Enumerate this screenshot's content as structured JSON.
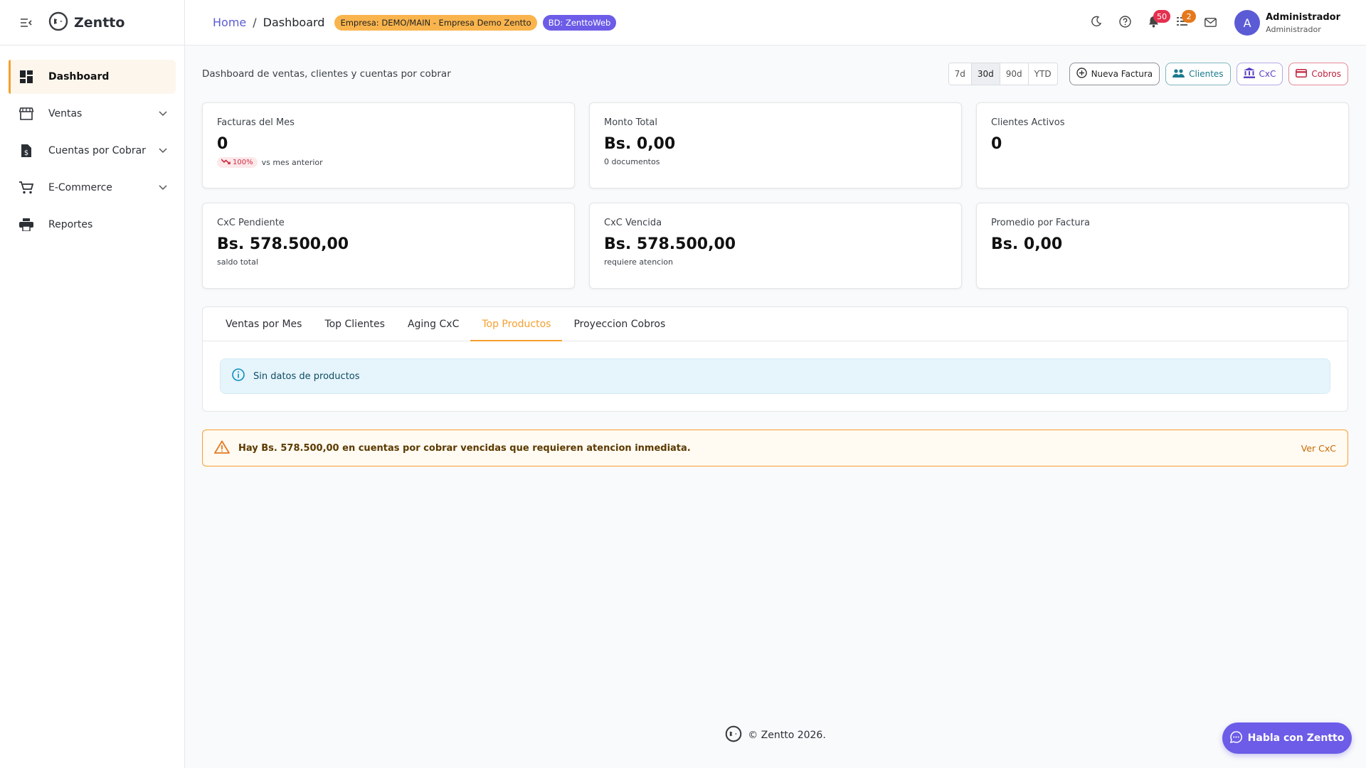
{
  "app": {
    "name": "Zentto"
  },
  "sidebar": {
    "items": [
      {
        "label": "Dashboard",
        "icon": "dashboard-icon"
      },
      {
        "label": "Ventas",
        "icon": "store-icon"
      },
      {
        "label": "Cuentas por Cobrar",
        "icon": "receipt-icon"
      },
      {
        "label": "E-Commerce",
        "icon": "cart-icon"
      },
      {
        "label": "Reportes",
        "icon": "printer-icon"
      }
    ]
  },
  "header": {
    "breadcrumb_home": "Home",
    "breadcrumb_sep": "/",
    "breadcrumb_current": "Dashboard",
    "chip_company": "Empresa: DEMO/MAIN - Empresa Demo Zentto",
    "chip_db": "BD: ZenttoWeb",
    "notifications_count": "50",
    "tasks_count": "2",
    "user": {
      "initial": "A",
      "name": "Administrador",
      "role": "Administrador"
    }
  },
  "dashboard": {
    "subtitle": "Dashboard de ventas, clientes y cuentas por cobrar",
    "ranges": [
      "7d",
      "30d",
      "90d",
      "YTD"
    ],
    "active_range": "30d",
    "actions": {
      "new_invoice": "Nueva Factura",
      "clients": "Clientes",
      "cxc": "CxC",
      "collections": "Cobros"
    },
    "kpis": [
      {
        "label": "Facturas del Mes",
        "value": "0",
        "delta": "100%",
        "sub": "vs mes anterior"
      },
      {
        "label": "Monto Total",
        "value": "Bs. 0,00",
        "sub": "0 documentos"
      },
      {
        "label": "Clientes Activos",
        "value": "0",
        "sub": ""
      },
      {
        "label": "CxC Pendiente",
        "value": "Bs. 578.500,00",
        "sub": "saldo total"
      },
      {
        "label": "CxC Vencida",
        "value": "Bs. 578.500,00",
        "sub": "requiere atencion"
      },
      {
        "label": "Promedio por Factura",
        "value": "Bs. 0,00",
        "sub": ""
      }
    ],
    "tabs": [
      "Ventas por Mes",
      "Top Clientes",
      "Aging CxC",
      "Top Productos",
      "Proyeccion Cobros"
    ],
    "active_tab": "Top Productos",
    "info_message": "Sin datos de productos",
    "alert": {
      "text": "Hay Bs. 578.500,00 en cuentas por cobrar vencidas que requieren atencion inmediata.",
      "link": "Ver CxC"
    }
  },
  "footer": {
    "text": "© Zentto 2026."
  },
  "chat": {
    "label": "Habla con Zentto"
  },
  "colors": {
    "accent": "#f5a030",
    "primary": "#5b5bd6",
    "chat": "#6c5ce7",
    "danger": "#e5304f"
  }
}
